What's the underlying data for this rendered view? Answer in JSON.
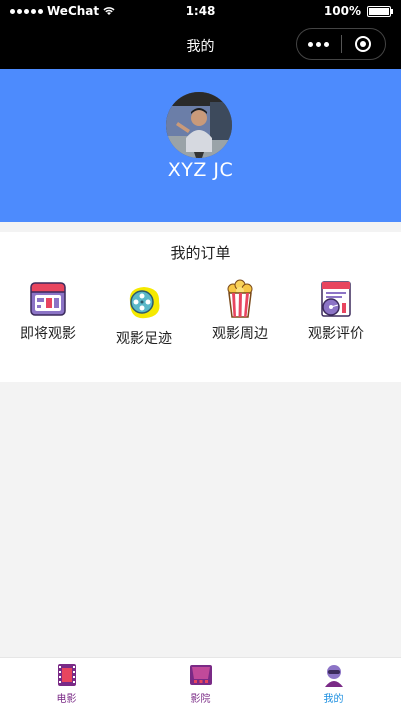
{
  "status_bar": {
    "carrier": "WeChat",
    "time": "1:48",
    "battery": "100%"
  },
  "nav": {
    "title": "我的"
  },
  "profile": {
    "name": "XYZ JC"
  },
  "orders": {
    "title": "我的订单",
    "items": [
      {
        "label": "即将观影",
        "icon": "ticket-icon"
      },
      {
        "label": "观影足迹",
        "icon": "film-reel-icon"
      },
      {
        "label": "观影周边",
        "icon": "popcorn-icon"
      },
      {
        "label": "观影评价",
        "icon": "review-icon"
      }
    ]
  },
  "tabbar": {
    "items": [
      {
        "label": "电影",
        "icon": "film-icon",
        "color": "#7a2a86"
      },
      {
        "label": "影院",
        "icon": "cinema-icon",
        "color": "#7a2a86"
      },
      {
        "label": "我的",
        "icon": "profile-icon",
        "color": "#1a8ee0",
        "active": true
      }
    ]
  }
}
